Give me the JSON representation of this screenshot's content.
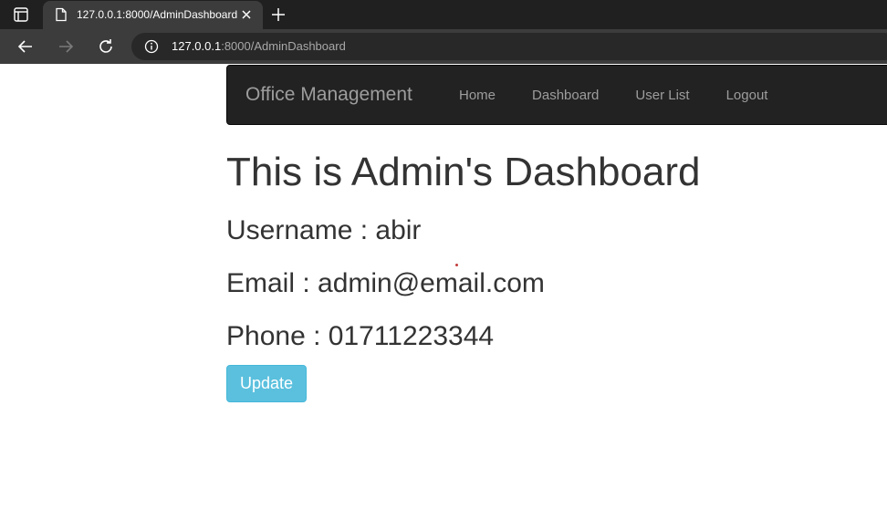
{
  "browser": {
    "tab_title": "127.0.0.1:8000/AdminDashboard",
    "url_host": "127.0.0.1",
    "url_rest": ":8000/AdminDashboard"
  },
  "navbar": {
    "brand": "Office Management",
    "links": [
      "Home",
      "Dashboard",
      "User List",
      "Logout"
    ]
  },
  "main": {
    "heading": "This is Admin's Dashboard",
    "username_line": "Username : abir",
    "email_line": "Email : admin@email.com",
    "phone_line": "Phone : 01711223344",
    "update_label": "Update"
  },
  "colors": {
    "navbar_bg": "#222222",
    "nav_text": "#9d9d9d",
    "update_button": "#5bc0de"
  }
}
